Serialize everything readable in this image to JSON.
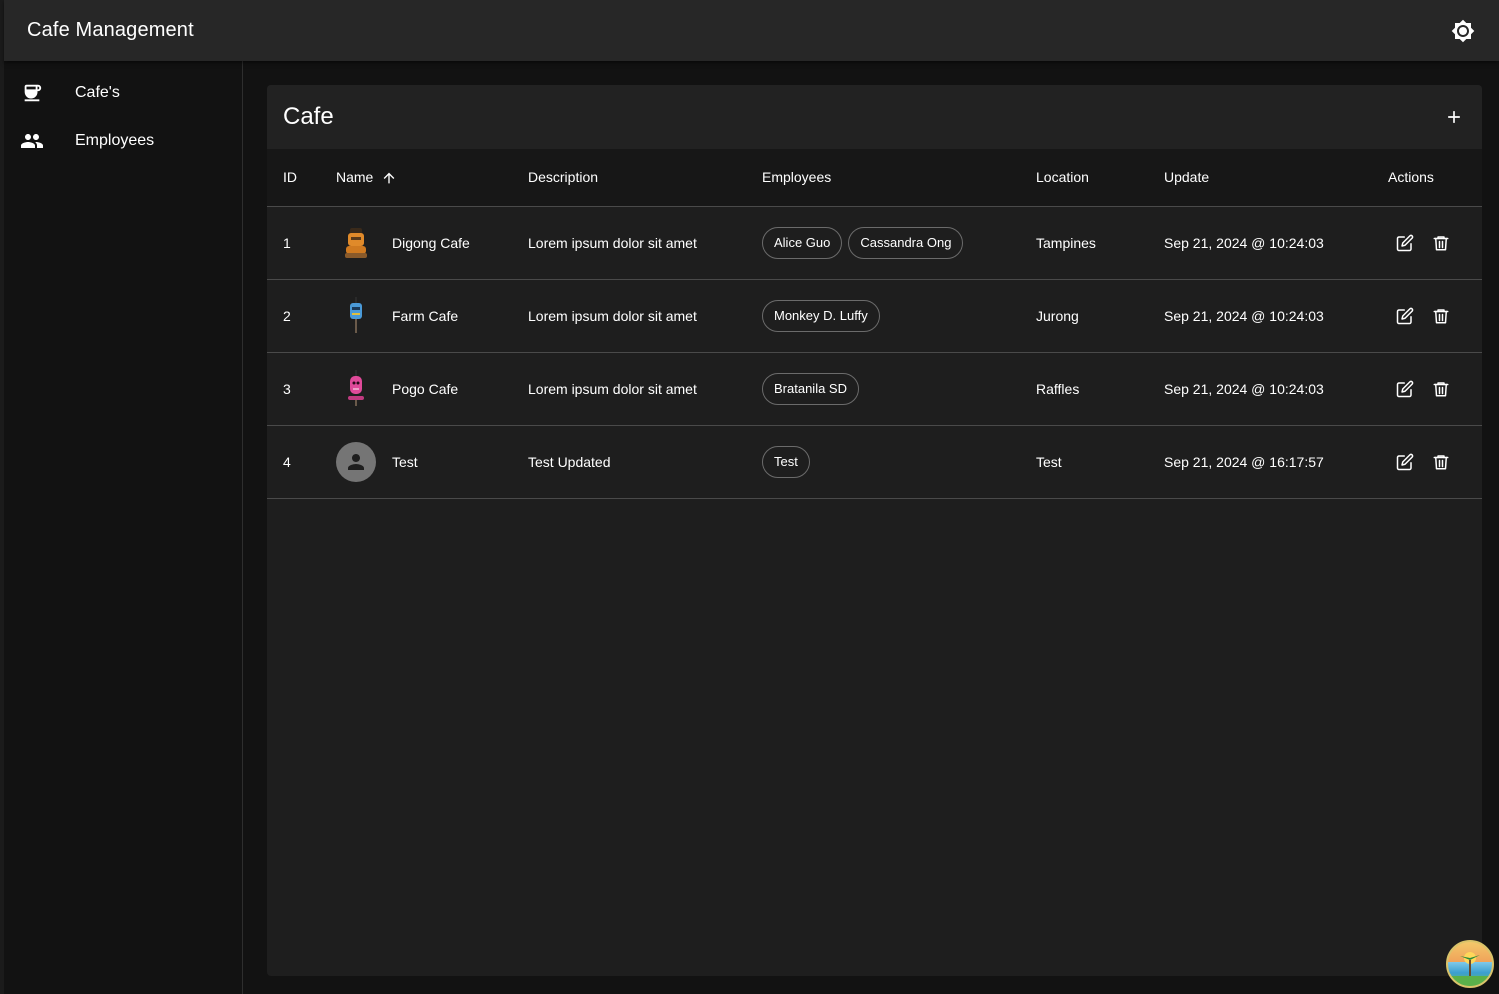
{
  "app": {
    "title": "Cafe Management"
  },
  "sidebar": {
    "items": [
      {
        "label": "Cafe's",
        "icon": "coffee-icon"
      },
      {
        "label": "Employees",
        "icon": "people-icon"
      }
    ]
  },
  "page": {
    "title": "Cafe"
  },
  "table": {
    "headers": [
      "ID",
      "Name",
      "Description",
      "Employees",
      "Location",
      "Update",
      "Actions"
    ],
    "sort": {
      "column": "Name",
      "direction": "asc"
    },
    "rows": [
      {
        "id": "1",
        "name": "Digong Cafe",
        "logo": "orange-robot-icon",
        "description": "Lorem ipsum dolor sit amet",
        "employees": [
          "Alice Guo",
          "Cassandra Ong"
        ],
        "location": "Tampines",
        "updated": "Sep 21, 2024 @ 10:24:03"
      },
      {
        "id": "2",
        "name": "Farm Cafe",
        "logo": "blue-robot-icon",
        "description": "Lorem ipsum dolor sit amet",
        "employees": [
          "Monkey D. Luffy"
        ],
        "location": "Jurong",
        "updated": "Sep 21, 2024 @ 10:24:03"
      },
      {
        "id": "3",
        "name": "Pogo Cafe",
        "logo": "pink-robot-icon",
        "description": "Lorem ipsum dolor sit amet",
        "employees": [
          "Bratanila SD"
        ],
        "location": "Raffles",
        "updated": "Sep 21, 2024 @ 10:24:03"
      },
      {
        "id": "4",
        "name": "Test",
        "logo": "person-avatar-icon",
        "description": "Test Updated",
        "employees": [
          "Test"
        ],
        "location": "Test",
        "updated": "Sep 21, 2024 @ 16:17:57"
      }
    ]
  },
  "colors": {
    "appbar": "#272727",
    "background": "#121212",
    "card": "#1e1e1e",
    "text": "#ffffff",
    "divider": "#4a4a4a"
  }
}
